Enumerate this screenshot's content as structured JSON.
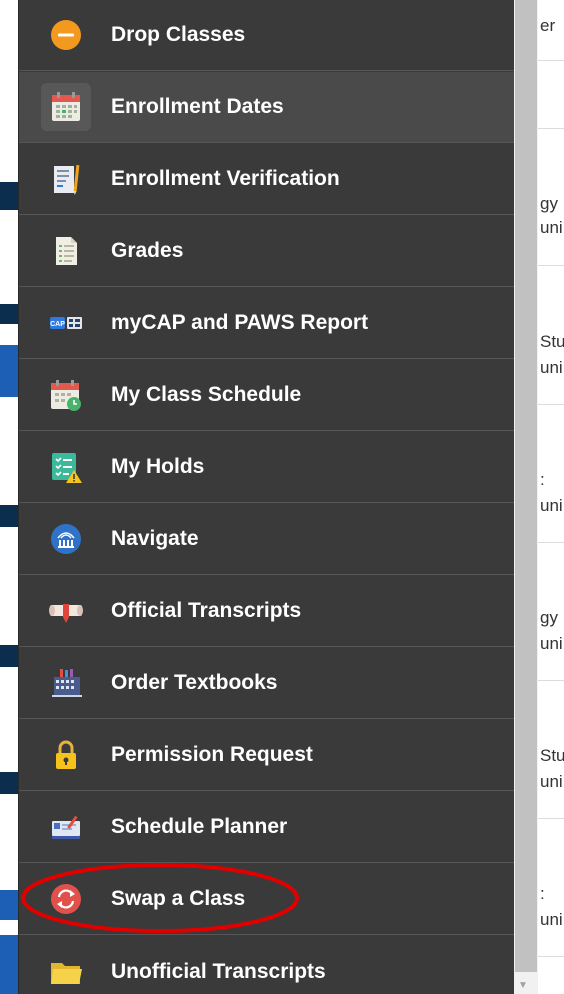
{
  "menu": {
    "items": [
      {
        "label": "Drop Classes",
        "icon": "drop-classes-icon"
      },
      {
        "label": "Enrollment Dates",
        "icon": "calendar-icon"
      },
      {
        "label": "Enrollment Verification",
        "icon": "verification-document-icon"
      },
      {
        "label": "Grades",
        "icon": "grades-document-icon"
      },
      {
        "label": "myCAP and PAWS Report",
        "icon": "mycap-paws-icon"
      },
      {
        "label": "My Class Schedule",
        "icon": "calendar-clock-icon"
      },
      {
        "label": "My Holds",
        "icon": "holds-checklist-icon"
      },
      {
        "label": "Navigate",
        "icon": "navigate-icon"
      },
      {
        "label": "Official Transcripts",
        "icon": "diploma-icon"
      },
      {
        "label": "Order Textbooks",
        "icon": "bookstore-icon"
      },
      {
        "label": "Permission Request",
        "icon": "lock-icon"
      },
      {
        "label": "Schedule Planner",
        "icon": "schedule-planner-icon"
      },
      {
        "label": "Swap a Class",
        "icon": "swap-icon"
      },
      {
        "label": "Unofficial Transcripts",
        "icon": "folder-icon"
      }
    ],
    "active_index": 1,
    "highlighted_index": 12
  },
  "background_page": {
    "fragments": [
      "er",
      "gy",
      "uni",
      "Stu",
      "uni",
      ":",
      "uni",
      "gy",
      "uni",
      "Stu",
      "uni",
      ":",
      "uni"
    ]
  },
  "colors": {
    "menu_bg": "#3a3a3a",
    "menu_text": "#ffffff",
    "annotation_red": "#e00000"
  }
}
